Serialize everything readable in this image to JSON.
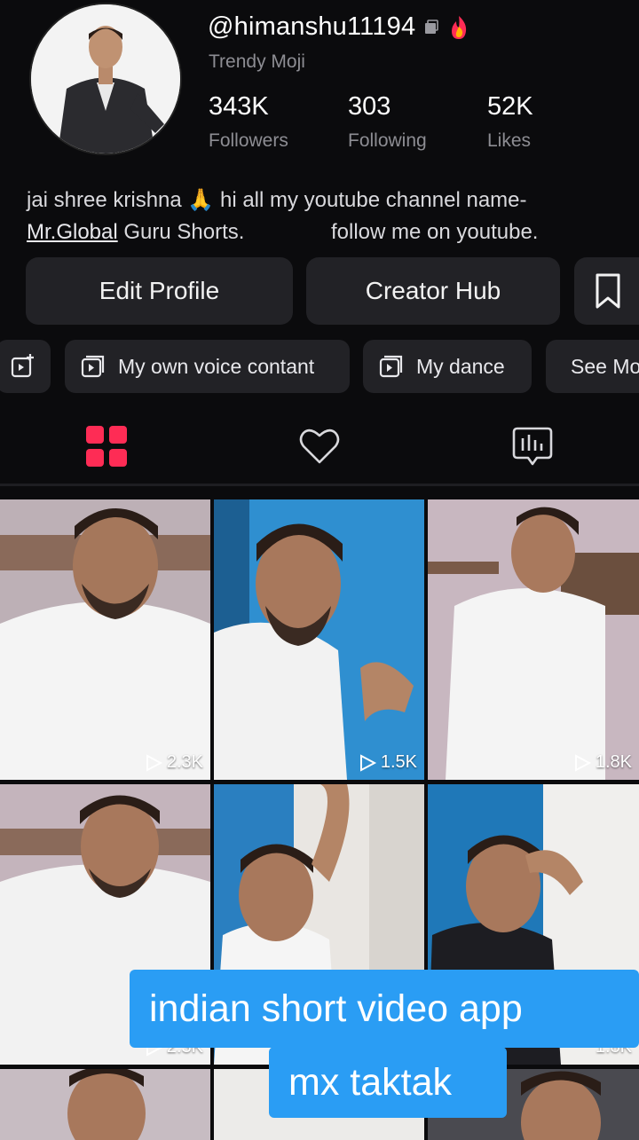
{
  "profile": {
    "username": "@himanshu11194",
    "subtitle": "Trendy Moji",
    "stats": [
      {
        "value": "343K",
        "label": "Followers"
      },
      {
        "value": "303",
        "label": "Following"
      },
      {
        "value": "52K",
        "label": "Likes"
      }
    ],
    "bio_line1": "jai shree krishna 🙏 hi all my youtube channel name-",
    "bio_link": "Mr.Global",
    "bio_line2_rest": " Guru Shorts.",
    "bio_line2_tail": "follow me on youtube."
  },
  "actions": {
    "edit_profile": "Edit Profile",
    "creator_hub": "Creator Hub"
  },
  "playlists": [
    {
      "label": "My own voice contant"
    },
    {
      "label": "My dance"
    },
    {
      "label": "See Mo"
    }
  ],
  "tabs": {
    "active": "videos"
  },
  "videos": [
    {
      "views": "2.3K"
    },
    {
      "views": "1.5K"
    },
    {
      "views": "1.8K"
    },
    {
      "views": "2.3K"
    },
    {
      "views": ""
    },
    {
      "views": "1.8K"
    }
  ],
  "overlay": {
    "line1": "indian short video app",
    "line2": "mx taktak"
  },
  "colors": {
    "accent": "#fe2c55",
    "caption_bg": "#2a9df4"
  }
}
